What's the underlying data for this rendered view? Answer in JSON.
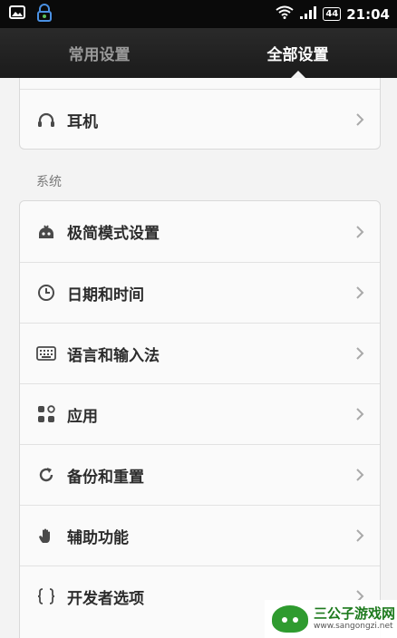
{
  "status_bar": {
    "time": "21:04",
    "battery": "44",
    "icons": [
      "image-notification-icon",
      "lock-app-icon",
      "wifi-icon",
      "signal-icon",
      "battery-icon"
    ]
  },
  "tabs": [
    {
      "label": "常用设置",
      "active": false
    },
    {
      "label": "全部设置",
      "active": true
    }
  ],
  "earphone_item": {
    "label": "耳机",
    "icon": "headphones-icon"
  },
  "system_section": {
    "title": "系统",
    "items": [
      {
        "label": "极简模式设置",
        "icon": "simple-mode-icon"
      },
      {
        "label": "日期和时间",
        "icon": "clock-icon"
      },
      {
        "label": "语言和输入法",
        "icon": "keyboard-icon"
      },
      {
        "label": "应用",
        "icon": "apps-icon"
      },
      {
        "label": "备份和重置",
        "icon": "backup-icon"
      },
      {
        "label": "辅助功能",
        "icon": "hand-icon"
      },
      {
        "label": "开发者选项",
        "icon": "braces-icon"
      }
    ]
  },
  "watermark": {
    "title": "三公子游戏网",
    "url": "www.sangongzi.net"
  },
  "colors": {
    "status_bar_bg": "#0a0a0a",
    "tab_bar_bg": "#1f1f1f",
    "page_bg": "#f3f3f3",
    "label_text": "#2c2c2c"
  }
}
